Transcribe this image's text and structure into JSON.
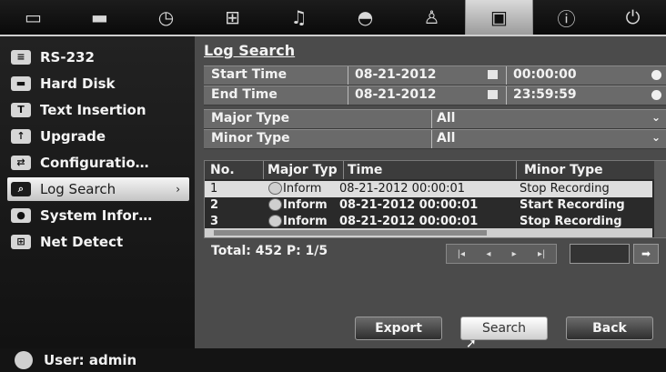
{
  "toolbar": {
    "icons": [
      "display-icon",
      "camera-icon",
      "clock-icon",
      "network-icon",
      "alarm-bell-icon",
      "ptz-dome-icon",
      "user-lock-icon",
      "device-icon",
      "info-icon",
      "power-icon"
    ],
    "active_index": 7
  },
  "sidebar": {
    "items": [
      {
        "label": "RS-232",
        "icon": "rs232-icon"
      },
      {
        "label": "Hard Disk",
        "icon": "hard-disk-icon"
      },
      {
        "label": "Text Insertion",
        "icon": "text-insertion-icon"
      },
      {
        "label": "Upgrade",
        "icon": "upgrade-icon"
      },
      {
        "label": "Configuratio…",
        "icon": "configuration-icon"
      },
      {
        "label": "Log Search",
        "icon": "search-icon",
        "arrow": "›"
      },
      {
        "label": "System Infor…",
        "icon": "info-icon"
      },
      {
        "label": "Net Detect",
        "icon": "network-icon"
      }
    ],
    "selected_index": 5
  },
  "main": {
    "title": "Log Search",
    "form": {
      "start_time_label": "Start Time",
      "start_date": "08-21-2012",
      "start_clock": "00:00:00",
      "end_time_label": "End Time",
      "end_date": "08-21-2012",
      "end_clock": "23:59:59",
      "major_type_label": "Major Type",
      "major_type_value": "All",
      "minor_type_label": "Minor Type",
      "minor_type_value": "All"
    },
    "table": {
      "headers": [
        "No.",
        "Major Typ",
        "Time",
        "Minor Type"
      ],
      "rows": [
        {
          "no": "1",
          "major": "Inform",
          "time": "08-21-2012 00:00:01",
          "minor": "Stop Recording"
        },
        {
          "no": "2",
          "major": "Inform",
          "time": "08-21-2012 00:00:01",
          "minor": "Start Recording"
        },
        {
          "no": "3",
          "major": "Inform",
          "time": "08-21-2012 00:00:01",
          "minor": "Stop Recording"
        }
      ],
      "selected_row": 0
    },
    "paging": {
      "total_text": "Total: 452  P: 1/5",
      "first": "|◂",
      "prev": "◂",
      "next": "▸",
      "last": "▸|",
      "go": "➡"
    },
    "buttons": {
      "export": "Export",
      "search": "Search",
      "back": "Back"
    }
  },
  "status": {
    "user": "User: admin"
  }
}
